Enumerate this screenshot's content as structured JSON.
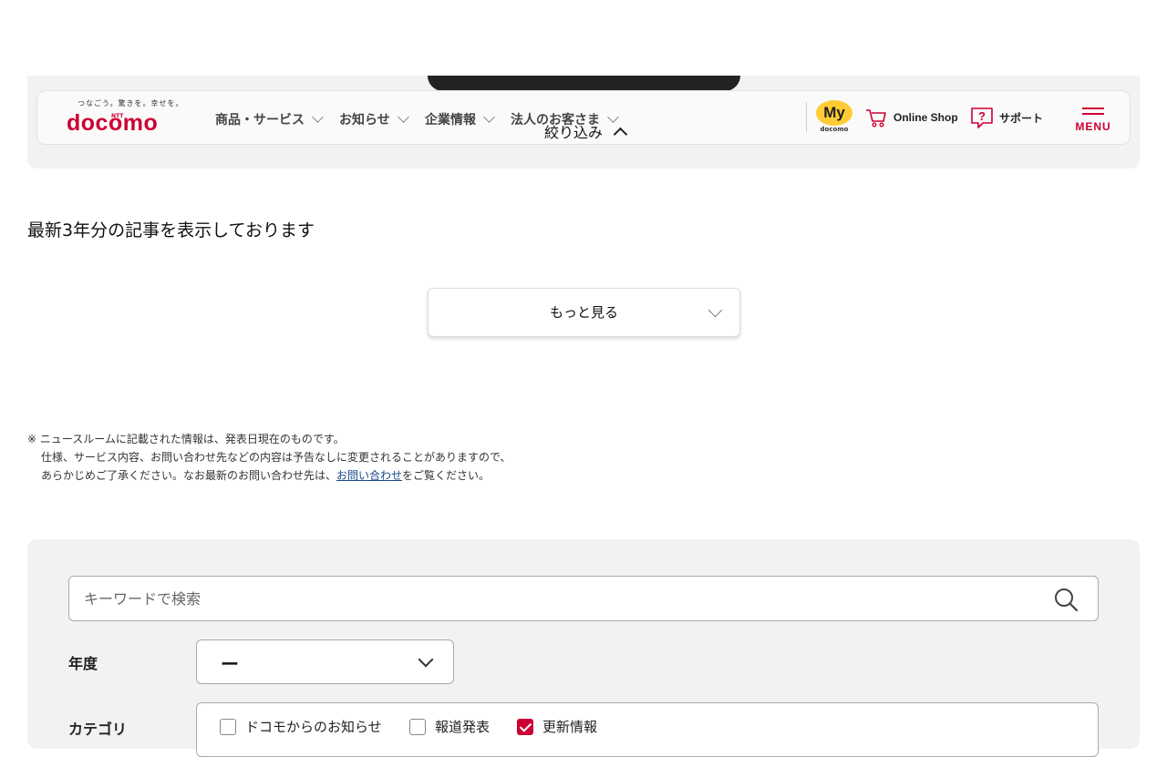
{
  "header": {
    "logo": {
      "tagline": "つなごう。驚きを。幸せを。",
      "wordmark": "docomo",
      "ntt": "NTT"
    },
    "nav": [
      {
        "label": "商品・サービス"
      },
      {
        "label": "お知らせ"
      },
      {
        "label": "企業情報"
      },
      {
        "label": "法人のお客さま"
      }
    ],
    "my_docomo": {
      "my": "My",
      "sub": "docomo"
    },
    "online_shop": "Online Shop",
    "support": "サポート",
    "menu": "MENU"
  },
  "filter_toggle": "絞り込み",
  "notice": "最新3年分の記事を表示しております",
  "more_button": "もっと見る",
  "note": {
    "line1": "※ ニュースルームに記載された情報は、発表日現在のものです。",
    "line2": "仕様、サービス内容、お問い合わせ先などの内容は予告なしに変更されることがありますので、",
    "line3_before": "あらかじめご了承ください。なお最新のお問い合わせ先は、",
    "line3_link": "お問い合わせ",
    "line3_after": "をご覧ください。"
  },
  "search": {
    "placeholder": "キーワードで検索",
    "year_label": "年度",
    "year_value": "ー",
    "category_label": "カテゴリ",
    "categories": [
      {
        "label": "ドコモからのお知らせ",
        "checked": false
      },
      {
        "label": "報道発表",
        "checked": false
      },
      {
        "label": "更新情報",
        "checked": true
      }
    ]
  },
  "colors": {
    "brand": "#cc0033",
    "my_badge": "#ffcc33",
    "panel": "#f2f2f2"
  }
}
